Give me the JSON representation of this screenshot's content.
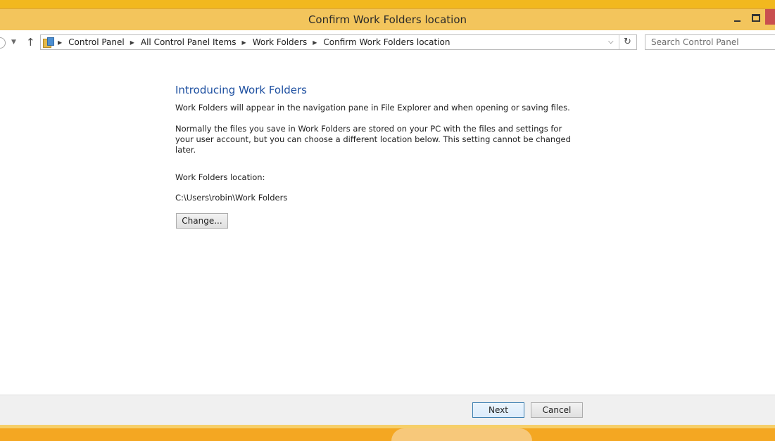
{
  "window": {
    "title": "Confirm Work Folders location",
    "minimize_icon": "minimize-icon",
    "maximize_icon": "maximize-icon",
    "close_icon": "close-icon",
    "accent_color": "#f3c55c",
    "close_color": "#c94f4f"
  },
  "nav": {
    "back_icon": "back-arrow-icon",
    "recent_icon": "chevron-down-icon",
    "up_icon": "up-arrow-icon",
    "up_glyph": "↑",
    "breadcrumb": [
      "Control Panel",
      "All Control Panel Items",
      "Work Folders",
      "Confirm Work Folders location"
    ],
    "address_dropdown_icon": "chevron-down-icon",
    "refresh_icon": "refresh-icon",
    "refresh_glyph": "↻",
    "search_placeholder": "Search Control Panel"
  },
  "main": {
    "heading": "Introducing Work Folders",
    "paragraph1": "Work Folders will appear in the navigation pane in File Explorer and when opening or saving files.",
    "paragraph2": "Normally the files you save in Work Folders are stored on your PC with the files and settings for your user account, but you can choose a different location below. This setting cannot be changed later.",
    "location_label": "Work Folders location:",
    "location_value": "C:\\Users\\robin\\Work Folders",
    "change_button": "Change...",
    "heading_color": "#1d4fa0"
  },
  "footer": {
    "next_button": "Next",
    "cancel_button": "Cancel"
  }
}
